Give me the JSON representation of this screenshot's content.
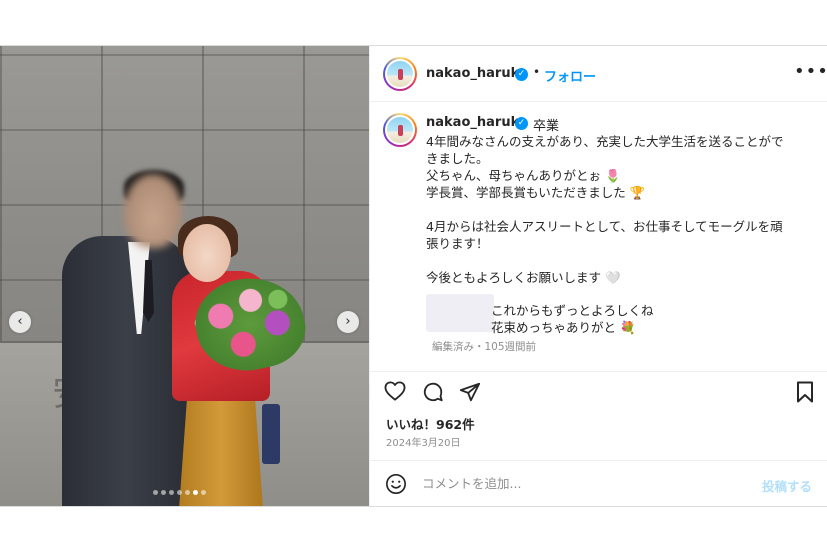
{
  "post": {
    "username": "nakao_haruka",
    "verified_glyph": "✓",
    "separator": "•",
    "follow_label": "フォロー",
    "more_glyph": "•••",
    "caption": {
      "title": "卒業",
      "lines": [
        "4年間みなさんの支えがあり、充実した大学生活を送ることがで",
        "きました。",
        "父ちゃん、母ちゃんありがとぉ 🌷",
        "学長賞、学部長賞もいただきました 🏆",
        "",
        "4月からは社会人アスリートとして、お仕事そしてモーグルを頑",
        "張ります！",
        "",
        "今後ともよろしくお願いします 🤍"
      ]
    },
    "reply": {
      "line1": "これからもずっとよろしくね",
      "line2": "花束めっちゃありがと 💐"
    },
    "edited_label": "編集済み・105週間前",
    "likes_label": "いいね！962件",
    "date_label": "2024年3月20日",
    "comment": {
      "placeholder": "コメントを追加...",
      "post_label": "投稿する"
    }
  },
  "photo": {
    "engraving": "安",
    "nav_prev_glyph": "‹",
    "nav_next_glyph": "›",
    "carousel_count": 7,
    "carousel_active": 6
  },
  "icons": {
    "head_avatar": "avatar-icon",
    "verified": "verified-badge-icon",
    "more": "more-options-icon",
    "like": "heart-icon",
    "comment": "comment-icon",
    "share": "share-icon",
    "save": "bookmark-icon",
    "emoji": "emoji-icon"
  },
  "colors": {
    "accent": "#0095f6",
    "secondary_text": "#8e8e8e",
    "post_button_disabled": "#b2dffc"
  }
}
